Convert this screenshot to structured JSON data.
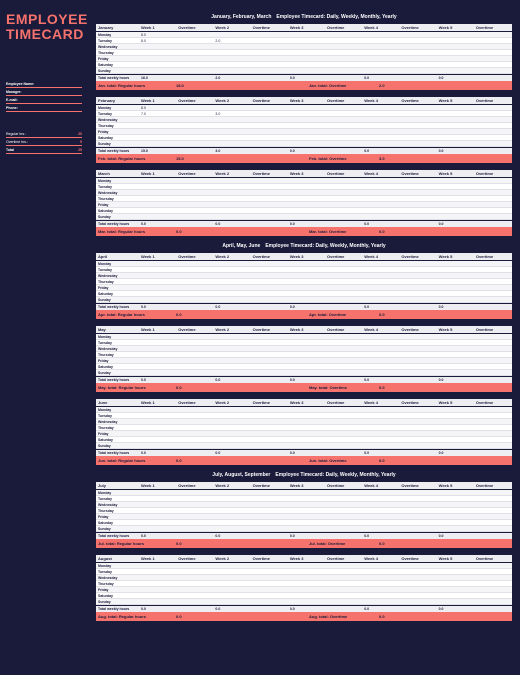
{
  "sidebar": {
    "title_l1": "EMPLOYEE",
    "title_l2": "TIMECARD",
    "fields": [
      {
        "label": "Employee Name:",
        "value": ""
      },
      {
        "label": "Manager:",
        "value": ""
      },
      {
        "label": "E-mail:",
        "value": ""
      },
      {
        "label": "Phone:",
        "value": ""
      }
    ],
    "summary": [
      {
        "label": "Regular hrs.:",
        "value": "20"
      },
      {
        "label": "Overtime hrs.:",
        "value": "5"
      },
      {
        "label": "Total",
        "value": "25"
      }
    ]
  },
  "columns": [
    "Week 1",
    "Overtime",
    "Week 2",
    "Overtime",
    "Week 3",
    "Overtime",
    "Week 4",
    "Overtime",
    "Week 5",
    "Overtime"
  ],
  "days": [
    "Monday",
    "Tuesday",
    "Wednesday",
    "Thursday",
    "Friday",
    "Saturday",
    "Sunday"
  ],
  "total_weekly_label": "Total weekly hours",
  "quarters": [
    {
      "header": "January, February, March Employee Timecard: Daily, Weekly, Monthly, Yearly",
      "months": [
        {
          "name": "January",
          "cells": {
            "Monday": [
              "8.0",
              "",
              "",
              "",
              "",
              "",
              "",
              "",
              "",
              ""
            ],
            "Tuesday": [
              "8.0",
              "",
              "2.0",
              "",
              "",
              "",
              "",
              "",
              "",
              ""
            ]
          },
          "weekly_totals": [
            "16.0",
            "",
            "2.0",
            "",
            "0.0",
            "",
            "0.0",
            "",
            "0.0",
            ""
          ],
          "footers": {
            "reg_label": "Jan. total: Regular hours",
            "reg": "18.0",
            "ot_label": "Jan. total: Overtime",
            "ot": "2.0"
          }
        },
        {
          "name": "February",
          "cells": {
            "Monday": [
              "8.0",
              "",
              "",
              "",
              "",
              "",
              "",
              "",
              "",
              ""
            ],
            "Tuesday": [
              "7.0",
              "",
              "3.0",
              "",
              "",
              "",
              "",
              "",
              "",
              ""
            ]
          },
          "weekly_totals": [
            "15.0",
            "",
            "3.0",
            "",
            "0.0",
            "",
            "0.0",
            "",
            "0.0",
            ""
          ],
          "footers": {
            "reg_label": "Feb. total: Regular hours",
            "reg": "15.0",
            "ot_label": "Feb. total: Overtime",
            "ot": "3.0"
          }
        },
        {
          "name": "March",
          "cells": {},
          "weekly_totals": [
            "0.0",
            "",
            "0.0",
            "",
            "0.0",
            "",
            "0.0",
            "",
            "0.0",
            ""
          ],
          "footers": {
            "reg_label": "Mar. total: Regular hours",
            "reg": "0.0",
            "ot_label": "Mar. total: Overtime",
            "ot": "0.0"
          }
        }
      ]
    },
    {
      "header": "April, May, June Employee Timecard: Daily, Weekly, Monthly, Yearly",
      "months": [
        {
          "name": "April",
          "cells": {},
          "weekly_totals": [
            "0.0",
            "",
            "0.0",
            "",
            "0.0",
            "",
            "0.0",
            "",
            "0.0",
            ""
          ],
          "footers": {
            "reg_label": "Apr. total: Regular hours",
            "reg": "0.0",
            "ot_label": "Apr. total: Overtime",
            "ot": "0.0"
          }
        },
        {
          "name": "May",
          "cells": {},
          "weekly_totals": [
            "0.0",
            "",
            "0.0",
            "",
            "0.0",
            "",
            "0.0",
            "",
            "0.0",
            ""
          ],
          "footers": {
            "reg_label": "May. total: Regular hours",
            "reg": "0.0",
            "ot_label": "May. total: Overtime",
            "ot": "0.0"
          }
        },
        {
          "name": "June",
          "cells": {},
          "weekly_totals": [
            "0.0",
            "",
            "0.0",
            "",
            "0.0",
            "",
            "0.0",
            "",
            "0.0",
            ""
          ],
          "footers": {
            "reg_label": "Jun. total: Regular hours",
            "reg": "0.0",
            "ot_label": "Jun. total: Overtime",
            "ot": "0.0"
          }
        }
      ]
    },
    {
      "header": "July, August, September Employee Timecard: Daily, Weekly, Monthly, Yearly",
      "months": [
        {
          "name": "July",
          "cells": {},
          "weekly_totals": [
            "0.0",
            "",
            "0.0",
            "",
            "0.0",
            "",
            "0.0",
            "",
            "0.0",
            ""
          ],
          "footers": {
            "reg_label": "Jul. total: Regular hours",
            "reg": "0.0",
            "ot_label": "Jul. total: Overtime",
            "ot": "0.0"
          }
        },
        {
          "name": "August",
          "cells": {},
          "weekly_totals": [
            "0.0",
            "",
            "0.0",
            "",
            "0.0",
            "",
            "0.0",
            "",
            "0.0",
            ""
          ],
          "footers": {
            "reg_label": "Aug. total: Regular hours",
            "reg": "0.0",
            "ot_label": "Aug. total: Overtime",
            "ot": "0.0"
          }
        }
      ]
    }
  ]
}
